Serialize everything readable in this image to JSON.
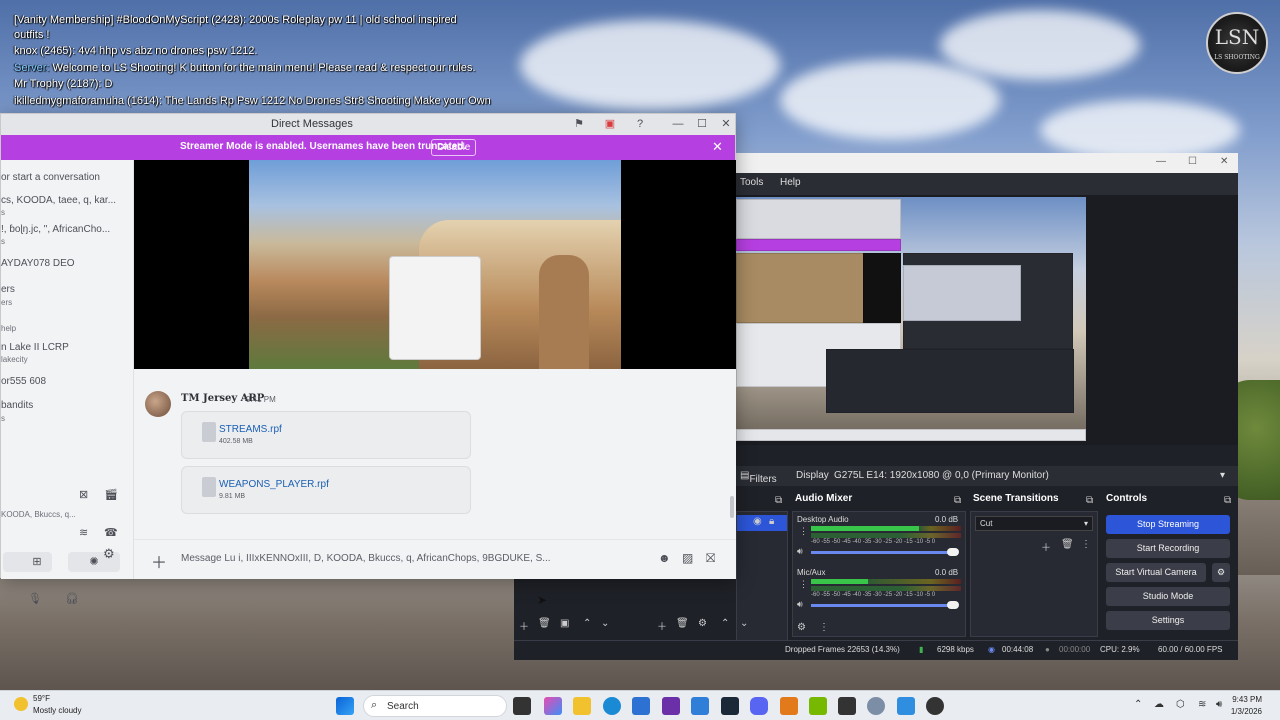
{
  "game_chat": [
    {
      "text": "[Vanity Membership] #BloodOnMyScript (2428): 2000s Roleplay pw 11 | old school inspired"
    },
    {
      "text": "outfits !"
    },
    {
      "text": "knox (2465): 4v4 hhp vs abz no drones psw 1212."
    },
    {
      "prefix": "Server:",
      "text": " Welcome to LS Shooting! K button for the main menu! Please read & respect our rules."
    },
    {
      "text": "Mr Trophy (2187): D"
    },
    {
      "text": "ikilledmygmaforamuha (1614): The Lands Rp Psw 1212 No Drones Str8 Shooting Make your Own"
    }
  ],
  "game_logo": {
    "big": "LSN",
    "small": "LS SHOOTING"
  },
  "discord": {
    "title": "Direct Messages",
    "streamer_banner": "Streamer Mode is enabled. Usernames have been truncated.",
    "disable_label": "Disable",
    "dm_list": [
      {
        "text": "or start a conversation",
        "small": false
      },
      {
        "text": "cs, KOODA, taee, q, kar...",
        "small": false
      },
      {
        "text": "s",
        "small": true
      },
      {
        "text": "!, ɓoɭŋ.jc, \", AfricanCho...",
        "small": false
      },
      {
        "text": "s",
        "small": true
      },
      {
        "text": "AYDAY078  DEO",
        "small": false
      },
      {
        "text": "ers",
        "small": false
      },
      {
        "text": "ers",
        "small": true
      },
      {
        "text": "help",
        "small": true
      },
      {
        "text": "n Lake II  LCRP",
        "small": false
      },
      {
        "text": "lakecity",
        "small": true
      },
      {
        "text": "or555  608",
        "small": false
      },
      {
        "text": "bandits",
        "small": false
      },
      {
        "text": "s",
        "small": true
      },
      {
        "text": "KOODA, Bkuccs, q...",
        "small": true
      }
    ],
    "message": {
      "author": "TM Jersey ARP",
      "time": "9:41 PM",
      "files": [
        {
          "name": "STREAMS.rpf",
          "size": "402.58 MB"
        },
        {
          "name": "WEAPONS_PLAYER.rpf",
          "size": "9.81 MB"
        }
      ]
    },
    "compose_placeholder": "Message Lu i, IIIxKENNOxIII, D, KOODA, Bkuccs, q, AfricanChops, 9BGDUKE, S..."
  },
  "obs": {
    "menu": {
      "tools": "Tools",
      "help": "Help"
    },
    "filters_label": "Filters",
    "display_label": "Display",
    "display_value": "G275L E14: 1920x1080 @ 0,0 (Primary Monitor)",
    "audio_mixer": {
      "title": "Audio Mixer",
      "channels": [
        {
          "name": "Desktop Audio",
          "db": "0.0 dB",
          "level": 0.72
        },
        {
          "name": "Mic/Aux",
          "db": "0.0 dB",
          "level": 0.38
        }
      ],
      "scale": "-60 -55 -50 -45 -40 -35 -30 -25 -20 -15 -10 -5 0"
    },
    "scene_transitions": {
      "title": "Scene Transitions",
      "value": "Cut"
    },
    "controls": {
      "title": "Controls",
      "stop_streaming": "Stop Streaming",
      "start_recording": "Start Recording",
      "start_virtual_camera": "Start Virtual Camera",
      "studio_mode": "Studio Mode",
      "settings": "Settings"
    },
    "status": {
      "dropped": "Dropped Frames 22653 (14.3%)",
      "bitrate": "6298 kbps",
      "stream_time": "00:44:08",
      "rec_time": "00:00:00",
      "cpu": "CPU: 2.9%",
      "fps": "60.00 / 60.00 FPS"
    }
  },
  "taskbar": {
    "weather_temp": "59°F",
    "weather_cond": "Mostly cloudy",
    "search": "Search",
    "time": "9:43 PM",
    "date": "1/3/2026"
  }
}
